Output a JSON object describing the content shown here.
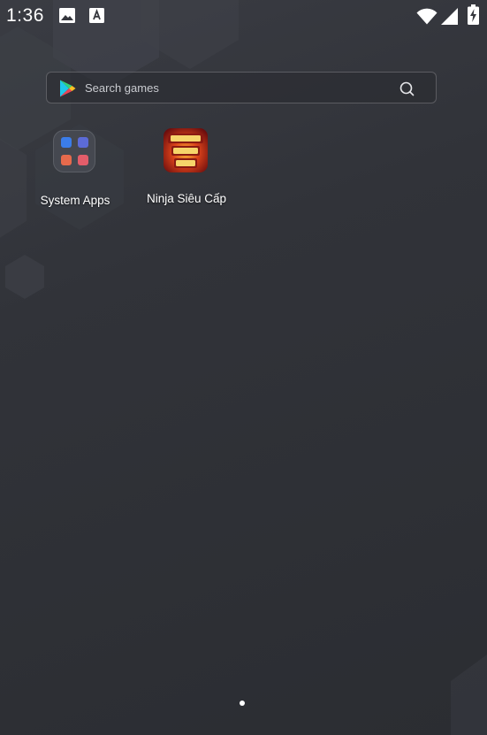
{
  "status_bar": {
    "time": "1:36",
    "notification_icons": [
      "image-icon",
      "text-a-icon"
    ],
    "system_icons": [
      "wifi-icon",
      "cellular-signal-icon",
      "battery-charging-icon"
    ]
  },
  "search": {
    "placeholder": "Search games",
    "provider_icon": "google-play-icon",
    "action_icon": "search-icon"
  },
  "apps": [
    {
      "label": "System Apps",
      "type": "folder"
    },
    {
      "label": "Ninja Siêu Cấp",
      "type": "app"
    }
  ],
  "home": {
    "page_count": 1,
    "current_page": 1
  }
}
